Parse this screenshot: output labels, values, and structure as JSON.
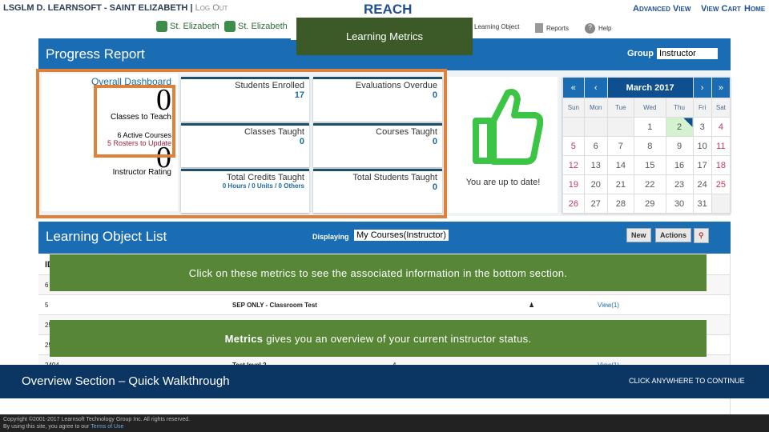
{
  "header": {
    "user": "LSGLM D. LEARNSOFT - SAINT ELIZABETH",
    "logout": "Log Out",
    "app": "REACH",
    "advanced_view": "Advanced View",
    "view_cart": "View Cart",
    "home": "Home"
  },
  "logos": [
    "St. Elizabeth",
    "St. Elizabeth"
  ],
  "nav": {
    "learning_object": "Learning Object",
    "reports": "Reports",
    "help": "Help"
  },
  "callout_title": "Learning Metrics",
  "progress": {
    "title": "Progress Report",
    "group_label": "Group",
    "group_value": "Instructor"
  },
  "overall": {
    "title": "Overall Dashboard",
    "classes_to_teach_value": "0",
    "classes_to_teach_label": "Classes to Teach",
    "active_courses": "6 Active Courses",
    "rosters": "5 Rosters to Update",
    "rating_value": "0",
    "rating_label": "Instructor Rating"
  },
  "tiles": [
    {
      "label": "Students Enrolled",
      "value": "17"
    },
    {
      "label": "Evaluations Overdue",
      "value": "0"
    },
    {
      "label": "Classes Taught",
      "value": "0"
    },
    {
      "label": "Courses Taught",
      "value": "0"
    },
    {
      "label": "Total Credits Taught",
      "value": "0 Hours / 0 Units / 0 Others"
    },
    {
      "label": "Total Students Taught",
      "value": "0"
    }
  ],
  "status_message": "You are up to date!",
  "calendar": {
    "month": "March  2017",
    "prev_year": "«",
    "prev": "‹",
    "next": "›",
    "next_year": "»",
    "days": [
      "Sun",
      "Mon",
      "Tue",
      "Wed",
      "Thu",
      "Fri",
      "Sat"
    ],
    "today": "2",
    "weeks": [
      [
        "",
        "",
        "",
        "1",
        "2",
        "3",
        "4"
      ],
      [
        "5",
        "6",
        "7",
        "8",
        "9",
        "10",
        "11"
      ],
      [
        "12",
        "13",
        "14",
        "15",
        "16",
        "17",
        "18"
      ],
      [
        "19",
        "20",
        "21",
        "22",
        "23",
        "24",
        "25"
      ],
      [
        "26",
        "27",
        "28",
        "29",
        "30",
        "31",
        ""
      ]
    ]
  },
  "lol": {
    "title": "Learning Object List",
    "displaying_label": "Displaying",
    "displaying_value": "My Courses(Instructor)",
    "new": "New",
    "actions": "Actions"
  },
  "table": {
    "header_id": "ID",
    "rows": [
      {
        "id": "6",
        "title": ""
      },
      {
        "id": "5",
        "title": "SEP ONLY - Classroom Test",
        "link": "View(1)"
      },
      {
        "id": "25",
        "title": ""
      },
      {
        "id": "25",
        "title": ""
      },
      {
        "id": "2494",
        "title": "Test level 2",
        "col3": "4",
        "link": "View(1)"
      }
    ]
  },
  "tips": {
    "tip1": "Click on these metrics to see the associated information in the bottom section.",
    "tip2_bold": "Metrics",
    "tip2_rest": " gives you an overview of your current instructor status."
  },
  "walkthrough": {
    "title": "Overview Section – Quick Walkthrough",
    "continue": "CLICK ANYWHERE TO CONTINUE"
  },
  "footer": {
    "copyright": "Copyright ©2001-2017 Learnsoft Technology Group Inc. All rights reserved.",
    "terms_prefix": "By using this site, you agree to our ",
    "terms": "Terms of Use"
  },
  "colors": {
    "brand_blue": "#1b6db3",
    "tip_green": "#578636",
    "callout_green": "#3b5a28",
    "highlight_orange": "#e0813a",
    "walkthrough_bar": "#0b3563"
  }
}
